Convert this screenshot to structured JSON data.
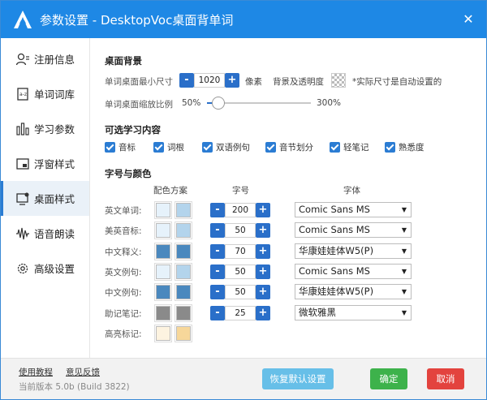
{
  "window": {
    "title": "参数设置 - DesktopVoc桌面背单词",
    "close_glyph": "✕",
    "titlebar_color": "#1e88e5"
  },
  "sidebar": {
    "items": [
      {
        "label": "注册信息",
        "icon": "user-icon"
      },
      {
        "label": "单词词库",
        "icon": "dictionary-icon"
      },
      {
        "label": "学习参数",
        "icon": "bar-chart-icon"
      },
      {
        "label": "浮窗样式",
        "icon": "floating-window-icon"
      },
      {
        "label": "桌面样式",
        "icon": "desktop-icon",
        "active": true
      },
      {
        "label": "语音朗读",
        "icon": "voice-wave-icon"
      },
      {
        "label": "高级设置",
        "icon": "gear-icon"
      }
    ]
  },
  "desktop_bg": {
    "section_title": "桌面背景",
    "min_size_label": "单词桌面最小尺寸",
    "min_size_value": "1020",
    "minus": "-",
    "plus": "+",
    "unit": "像素",
    "bg_alpha_label": "背景及透明度",
    "note": "*实际尺寸是自动设置的",
    "scale_label": "单词桌面缩放比例",
    "scale_min": "50%",
    "scale_max": "300%",
    "scale_fraction": 0.11
  },
  "optional": {
    "section_title": "可选学习内容",
    "items": [
      "音标",
      "词根",
      "双语例句",
      "音节划分",
      "轻笔记",
      "熟悉度"
    ]
  },
  "fonts": {
    "section_title": "字号与颜色",
    "col_scheme": "配色方案",
    "col_size": "字号",
    "col_font": "字体",
    "rows": [
      {
        "label": "英文单词:",
        "colors": [
          "#e6f2fb",
          "#b3d4ec"
        ],
        "size": "200",
        "font": "Comic Sans MS"
      },
      {
        "label": "美英音标:",
        "colors": [
          "#e6f2fb",
          "#b3d4ec"
        ],
        "size": "50",
        "font": "Comic Sans MS"
      },
      {
        "label": "中文释义:",
        "colors": [
          "#4a88be",
          "#4a88be"
        ],
        "size": "70",
        "font": "华康娃娃体W5(P)"
      },
      {
        "label": "英文例句:",
        "colors": [
          "#e6f2fb",
          "#b3d4ec"
        ],
        "size": "50",
        "font": "Comic Sans MS"
      },
      {
        "label": "中文例句:",
        "colors": [
          "#4a88be",
          "#4a88be"
        ],
        "size": "50",
        "font": "华康娃娃体W5(P)"
      },
      {
        "label": "助记笔记:",
        "colors": [
          "#8a8a8a",
          "#8a8a8a"
        ],
        "size": "25",
        "font": "微软雅黑"
      },
      {
        "label": "高亮标记:",
        "colors": [
          "#fdf3e0",
          "#f7d79a"
        ]
      }
    ]
  },
  "footer": {
    "tutorial": "使用教程",
    "feedback": "意见反馈",
    "version": "当前版本 5.0b (Build 3822)",
    "restore": "恢复默认设置",
    "ok": "确定",
    "cancel": "取消",
    "restore_color": "#67bfe8",
    "ok_color": "#3db24b",
    "cancel_color": "#e3433e"
  }
}
